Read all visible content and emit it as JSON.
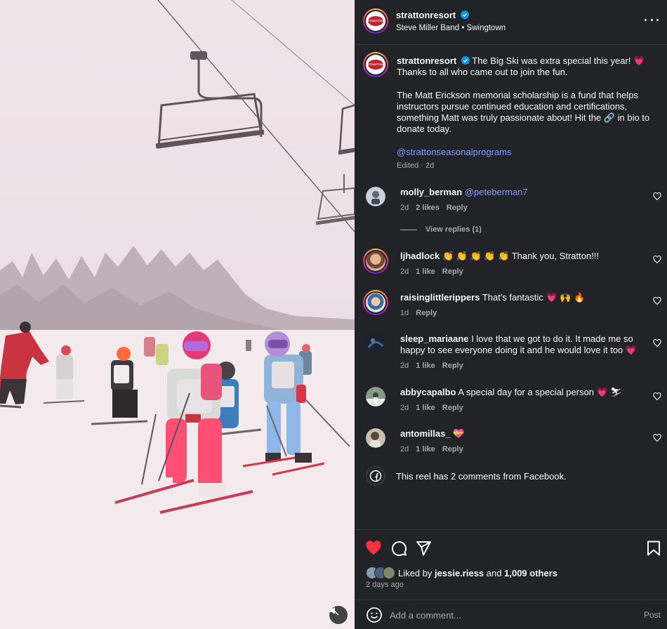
{
  "header": {
    "username": "strattonresort",
    "audio": "Steve Miller Band • Swingtown",
    "logo_text": "STRATTON"
  },
  "caption": {
    "username": "strattonresort",
    "line1": "The Big Ski was extra special this year! 💗 Thanks to all who came out to join the fun.",
    "line2": "The Matt Erickson memorial scholarship is a fund that helps instructors pursue continued education and certifications, something Matt was truly passionate about! Hit the 🔗 in bio to donate today.",
    "mention": "@strattonseasonalprograms",
    "meta": "Edited · 2d"
  },
  "comments": [
    {
      "user": "molly_berman",
      "text": "@peteberman7",
      "time": "2d",
      "likes": "2 likes",
      "reply": "Reply",
      "mention": true
    },
    {
      "user": "ljhadlock",
      "text": "👏 👏 👏 👏 👏 Thank you, Stratton!!!",
      "time": "2d",
      "likes": "1 like",
      "reply": "Reply"
    },
    {
      "user": "raisinglittlerippers",
      "text": "That's fantastic 💗 🙌 🔥",
      "time": "1d",
      "likes": "",
      "reply": "Reply"
    },
    {
      "user": "sleep_mariaane",
      "text": "I love that we got to do it. It made me so happy to see everyone doing it and he would love it too 💗",
      "time": "2d",
      "likes": "1 like",
      "reply": "Reply"
    },
    {
      "user": "abbycapalbo",
      "text": "A special day for a special person 💗 ⛷",
      "time": "2d",
      "likes": "1 like",
      "reply": "Reply"
    },
    {
      "user": "antomillas_",
      "text": "💝",
      "time": "2d",
      "likes": "1 like",
      "reply": "Reply"
    }
  ],
  "view_replies": "View replies (1)",
  "facebook": "This reel has 2 comments from Facebook.",
  "liked": {
    "prefix": "Liked by",
    "user": "jessie.riess",
    "and": "and",
    "others": "1,009 others",
    "date": "2 days ago"
  },
  "add_comment": {
    "placeholder": "Add a comment...",
    "post": "Post"
  },
  "colors": {
    "panel": "#212328",
    "heart": "#ff3040",
    "link": "#7f9fff",
    "muted": "#a8a8a8"
  }
}
